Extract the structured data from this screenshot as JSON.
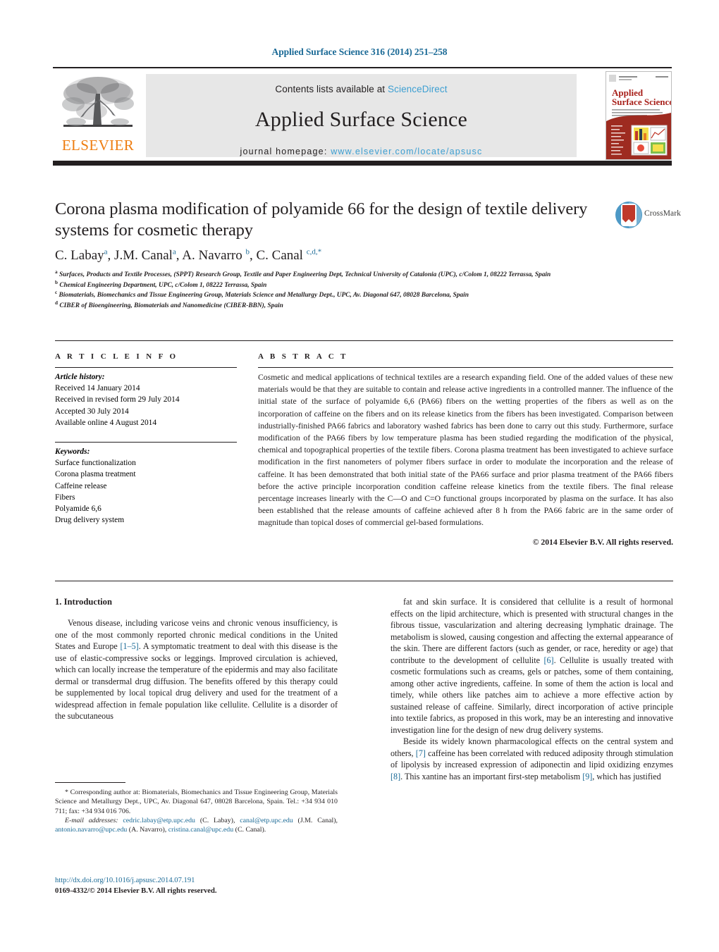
{
  "running_head": "Applied Surface Science 316 (2014) 251–258",
  "masthead": {
    "publisher_name": "ELSEVIER",
    "contents_prefix": "Contents lists available at",
    "sciencedirect": "ScienceDirect",
    "journal_title": "Applied Surface Science",
    "homepage_prefix": "journal homepage:",
    "homepage_url": "www.elsevier.com/locate/apsusc",
    "cover_title_line1": "Applied",
    "cover_title_line2": "Surface Science",
    "accent_blue": "#3d9fd2",
    "elsevier_orange": "#ee7d11",
    "rule_black": "#231f20",
    "panel_gray": "#e7e7e7"
  },
  "crossmark": {
    "label": "CrossMark"
  },
  "article": {
    "title": "Corona plasma modification of polyamide 66 for the design of textile delivery systems for cosmetic therapy",
    "authors_html": "C. Labay<sup>a</sup>, J.M. Canal<sup>a</sup>, A. Navarro <sup>b</sup>, C. Canal <sup>c,d,</sup><sup>*</sup>",
    "affiliations": [
      "Surfaces, Products and Textile Processes, (SPPT) Research Group, Textile and Paper Engineering Dept, Technical University of Catalonia (UPC), c/Colom 1, 08222 Terrassa, Spain",
      "Chemical Engineering Department, UPC, c/Colom 1, 08222 Terrassa, Spain",
      "Biomaterials, Biomechanics and Tissue Engineering Group, Materials Science and Metallurgy Dept., UPC, Av. Diagonal 647, 08028 Barcelona, Spain",
      "CIBER of Bioengineering, Biomaterials and Nanomedicine (CIBER-BBN), Spain"
    ],
    "affiliation_markers": [
      "a",
      "b",
      "c",
      "d"
    ]
  },
  "article_info": {
    "heading": "A R T I C L E   I N F O",
    "history_label": "Article history:",
    "history": [
      "Received 14 January 2014",
      "Received in revised form 29 July 2014",
      "Accepted 30 July 2014",
      "Available online 4 August 2014"
    ],
    "keywords_label": "Keywords:",
    "keywords": [
      "Surface functionalization",
      "Corona plasma treatment",
      "Caffeine release",
      "Fibers",
      "Polyamide 6,6",
      "Drug delivery system"
    ]
  },
  "abstract": {
    "heading": "A B S T R A C T",
    "text": "Cosmetic and medical applications of technical textiles are a research expanding field. One of the added values of these new materials would be that they are suitable to contain and release active ingredients in a controlled manner. The influence of the initial state of the surface of polyamide 6,6 (PA66) fibers on the wetting properties of the fibers as well as on the incorporation of caffeine on the fibers and on its release kinetics from the fibers has been investigated. Comparison between industrially-finished PA66 fabrics and laboratory washed fabrics has been done to carry out this study. Furthermore, surface modification of the PA66 fibers by low temperature plasma has been studied regarding the modification of the physical, chemical and topographical properties of the textile fibers. Corona plasma treatment has been investigated to achieve surface modification in the first nanometers of polymer fibers surface in order to modulate the incorporation and the release of caffeine. It has been demonstrated that both initial state of the PA66 surface and prior plasma treatment of the PA66 fibers before the active principle incorporation condition caffeine release kinetics from the textile fibers. The final release percentage increases linearly with the C—O and C=O functional groups incorporated by plasma on the surface. It has also been established that the release amounts of caffeine achieved after 8 h from the PA66 fabric are in the same order of magnitude than topical doses of commercial gel-based formulations.",
    "copyright": "© 2014 Elsevier B.V. All rights reserved."
  },
  "body": {
    "section_number_title": "1.  Introduction",
    "left_paragraph_1_a": "Venous disease, including varicose veins and chronic venous insufficiency, is one of the most commonly reported chronic medical conditions in the United States and Europe ",
    "left_ref_1": "[1–5]",
    "left_paragraph_1_b": ". A symptomatic treatment to deal with this disease is the use of elastic-compressive socks or leggings. Improved circulation is achieved, which can locally increase the temperature of the epidermis and may also facilitate dermal or transdermal drug diffusion. The benefits offered by this therapy could be supplemented by local topical drug delivery and used for the treatment of a widespread affection in female population like cellulite. Cellulite is a disorder of the subcutaneous",
    "right_paragraph_1_a": "fat and skin surface. It is considered that cellulite is a result of hormonal effects on the lipid architecture, which is presented with structural changes in the fibrous tissue, vascularization and altering decreasing lymphatic drainage. The metabolism is slowed, causing congestion and affecting the external appearance of the skin. There are different factors (such as gender, or race, heredity or age) that contribute to the development of cellulite ",
    "right_ref_6": "[6]",
    "right_paragraph_1_b": ". Cellulite is usually treated with cosmetic formulations such as creams, gels or patches, some of them containing, among other active ingredients, caffeine. In some of them the action is local and timely, while others like patches aim to achieve a more effective action by sustained release of caffeine. Similarly, direct incorporation of active principle into textile fabrics, as proposed in this work, may be an interesting and innovative investigation line for the design of new drug delivery systems.",
    "right_paragraph_2_a": "Beside its widely known pharmacological effects on the central system and others, ",
    "right_ref_7": "[7]",
    "right_paragraph_2_b": " caffeine has been correlated with reduced adiposity through stimulation of lipolysis by increased expression of adiponectin and lipid oxidizing enzymes ",
    "right_ref_8": "[8]",
    "right_paragraph_2_c": ". This xantine has an important first-step metabolism ",
    "right_ref_9": "[9]",
    "right_paragraph_2_d": ", which has justified"
  },
  "footnote": {
    "star": "*",
    "corresponding_text": " Corresponding author at: Biomaterials, Biomechanics and Tissue Engineering Group, Materials Science and Metallurgy Dept., UPC, Av. Diagonal 647, 08028 Barcelona, Spain. Tel.: +34 934 010 711; fax: +34 934 016 706.",
    "email_label": "E-mail addresses:",
    "emails": [
      {
        "address": "cedric.labay@etp.upc.edu",
        "person": " (C. Labay),"
      },
      {
        "address": "canal@etp.upc.edu",
        "person": " (J.M. Canal),"
      },
      {
        "address": "antonio.navarro@upc.edu",
        "person": " (A. Navarro),"
      },
      {
        "address": "cristina.canal@upc.edu",
        "person": " (C. Canal)."
      }
    ]
  },
  "doi": {
    "url": "http://dx.doi.org/10.1016/j.apsusc.2014.07.191",
    "issn_line": "0169-4332/© 2014 Elsevier B.V. All rights reserved."
  }
}
